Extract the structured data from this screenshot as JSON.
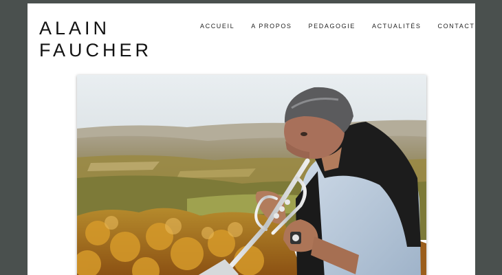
{
  "site": {
    "title_line1": "ALAIN",
    "title_line2": "FAUCHER"
  },
  "nav": {
    "items": [
      {
        "label": "ACCUEIL"
      },
      {
        "label": "A PROPOS"
      },
      {
        "label": "PEDAGOGIE"
      },
      {
        "label": "ACTUALITÉS"
      },
      {
        "label": "CONTACT"
      }
    ]
  },
  "hero": {
    "subject": "trumpet-player-photo"
  },
  "colors": {
    "background": "#4a504e",
    "page": "#ffffff",
    "text": "#111111",
    "sky": "#e7ecef",
    "foliage": "#c98a24"
  }
}
